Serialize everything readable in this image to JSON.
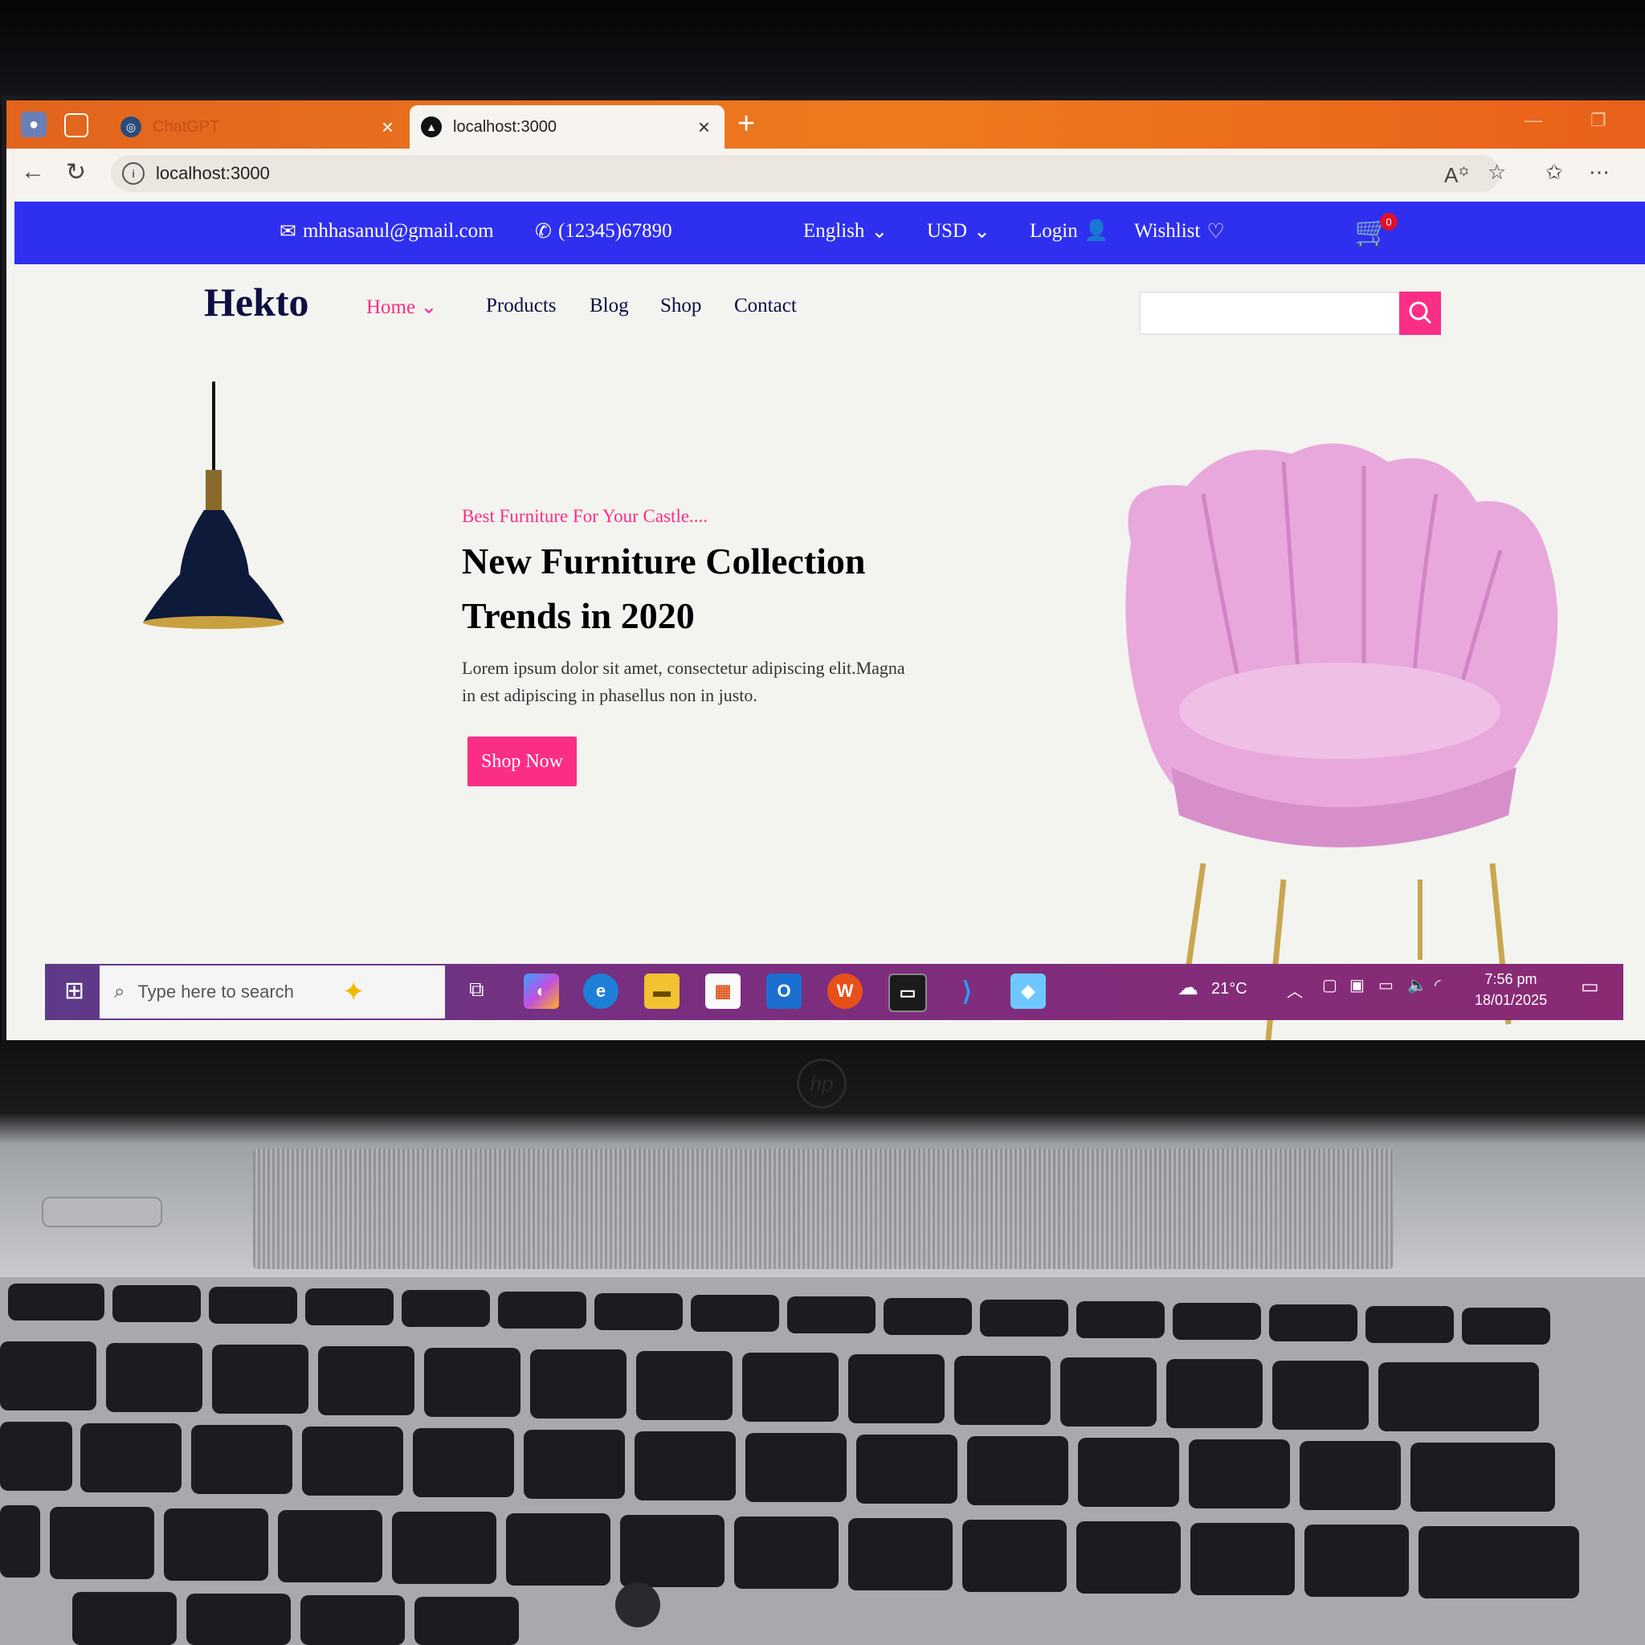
{
  "browser": {
    "tabs": [
      {
        "label": "ChatGPT",
        "active": false
      },
      {
        "label": "localhost:3000",
        "active": true
      }
    ],
    "url": "localhost:3000"
  },
  "site": {
    "topbar": {
      "email": "mhhasanul@gmail.com",
      "phone": "(12345)67890",
      "language": "English",
      "currency": "USD",
      "login": "Login",
      "wishlist": "Wishlist",
      "cart_count": "0"
    },
    "logo": "Hekto",
    "nav": [
      "Home",
      "Products",
      "Blog",
      "Shop",
      "Contact"
    ],
    "hero": {
      "subtitle": "Best Furniture For Your Castle....",
      "title_line1": "New Furniture Collection",
      "title_line2": "Trends in 2020",
      "description_line1": "Lorem ipsum dolor sit amet, consectetur adipiscing elit.Magna",
      "description_line2": "in est adipiscing in phasellus non in justo.",
      "cta": "Shop Now"
    }
  },
  "taskbar": {
    "search_placeholder": "Type here to search",
    "temperature": "21°C",
    "time": "7:56 pm",
    "date": "18/01/2025"
  },
  "colors": {
    "topbar": "#2f2ff0",
    "accent_pink": "#fb2e86",
    "navy": "#0d0e43",
    "tab_orange": "#ee7a1e"
  }
}
